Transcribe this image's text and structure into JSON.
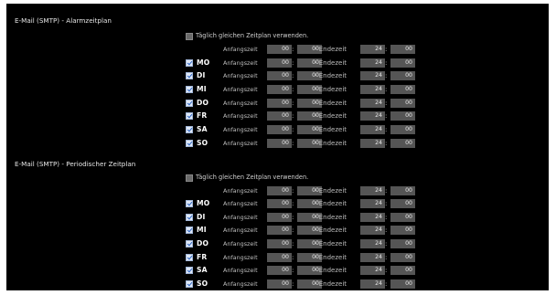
{
  "labels": {
    "start": "Anfangszeit",
    "end": "- Endezeit",
    "sep": ":"
  },
  "sections": [
    {
      "title": "E-Mail (SMTP) - Alarmzeitplan",
      "same_schedule": {
        "label": "Täglich gleichen Zeitplan verwenden.",
        "checked": false,
        "start_h": "00",
        "start_m": "00",
        "end_h": "24",
        "end_m": "00"
      },
      "days": [
        {
          "day": "MO",
          "checked": true,
          "start_h": "00",
          "start_m": "00",
          "end_h": "24",
          "end_m": "00"
        },
        {
          "day": "DI",
          "checked": true,
          "start_h": "00",
          "start_m": "00",
          "end_h": "24",
          "end_m": "00"
        },
        {
          "day": "MI",
          "checked": true,
          "start_h": "00",
          "start_m": "00",
          "end_h": "24",
          "end_m": "00"
        },
        {
          "day": "DO",
          "checked": true,
          "start_h": "00",
          "start_m": "00",
          "end_h": "24",
          "end_m": "00"
        },
        {
          "day": "FR",
          "checked": true,
          "start_h": "00",
          "start_m": "00",
          "end_h": "24",
          "end_m": "00"
        },
        {
          "day": "SA",
          "checked": true,
          "start_h": "00",
          "start_m": "00",
          "end_h": "24",
          "end_m": "00"
        },
        {
          "day": "SO",
          "checked": true,
          "start_h": "00",
          "start_m": "00",
          "end_h": "24",
          "end_m": "00"
        }
      ]
    },
    {
      "title": "E-Mail (SMTP) - Periodischer Zeitplan",
      "same_schedule": {
        "label": "Täglich gleichen Zeitplan verwenden.",
        "checked": false,
        "start_h": "00",
        "start_m": "00",
        "end_h": "24",
        "end_m": "00"
      },
      "days": [
        {
          "day": "MO",
          "checked": true,
          "start_h": "00",
          "start_m": "00",
          "end_h": "24",
          "end_m": "00"
        },
        {
          "day": "DI",
          "checked": true,
          "start_h": "00",
          "start_m": "00",
          "end_h": "24",
          "end_m": "00"
        },
        {
          "day": "MI",
          "checked": true,
          "start_h": "00",
          "start_m": "00",
          "end_h": "24",
          "end_m": "00"
        },
        {
          "day": "DO",
          "checked": true,
          "start_h": "00",
          "start_m": "00",
          "end_h": "24",
          "end_m": "00"
        },
        {
          "day": "FR",
          "checked": true,
          "start_h": "00",
          "start_m": "00",
          "end_h": "24",
          "end_m": "00"
        },
        {
          "day": "SA",
          "checked": true,
          "start_h": "00",
          "start_m": "00",
          "end_h": "24",
          "end_m": "00"
        },
        {
          "day": "SO",
          "checked": true,
          "start_h": "00",
          "start_m": "00",
          "end_h": "24",
          "end_m": "00"
        }
      ]
    }
  ]
}
